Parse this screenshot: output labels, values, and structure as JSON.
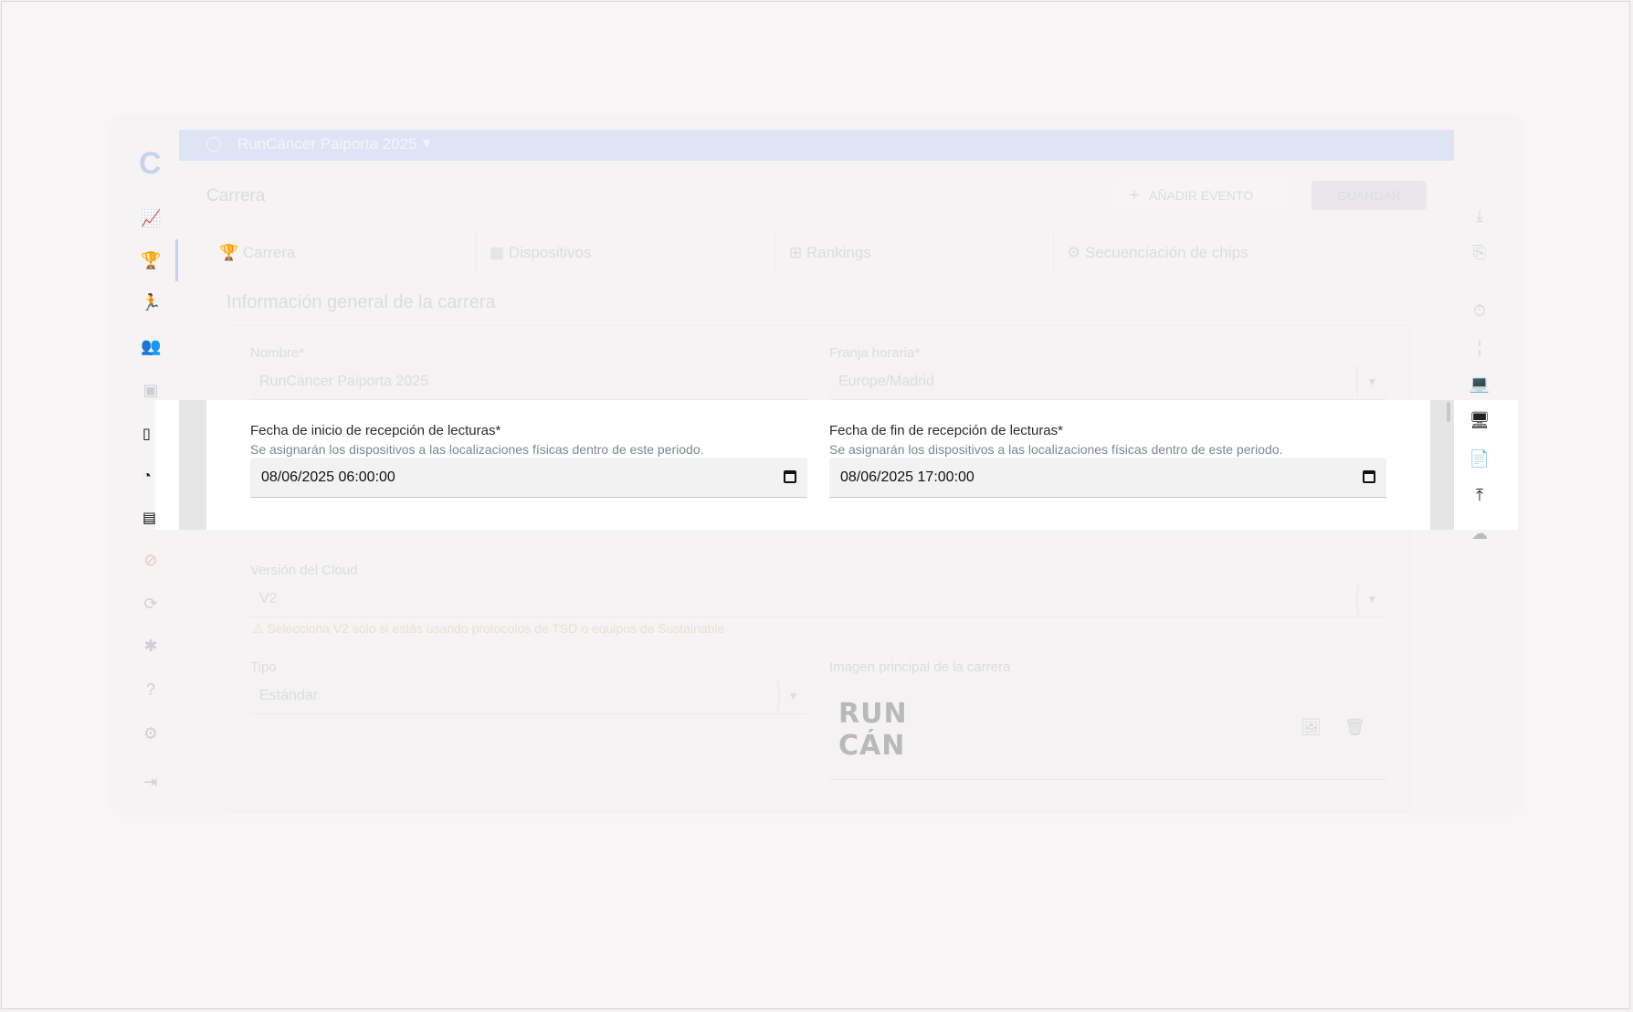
{
  "event_selector": {
    "label": "RunCáncer Paiporta 2025"
  },
  "page": {
    "title": "Carrera",
    "add_event_label": "AÑADIR EVENTO",
    "save_label": "GUARDAR"
  },
  "tabs": [
    {
      "label": "Carrera"
    },
    {
      "label": "Dispositivos"
    },
    {
      "label": "Rankings"
    },
    {
      "label": "Secuenciación de chips"
    }
  ],
  "section": {
    "title": "Información general de la carrera"
  },
  "form": {
    "name": {
      "label": "Nombre*",
      "value": "RunCáncer Paiporta 2025"
    },
    "timezone": {
      "label": "Franja horaria*",
      "value": "Europe/Madrid"
    },
    "start_reading": {
      "label": "Fecha de inicio de recepción de lecturas*",
      "help": "Se asignarán los dispositivos a las localizaciones físicas dentro de este periodo.",
      "value": "08/06/2025 06:00:00"
    },
    "end_reading": {
      "label": "Fecha de fin de recepción de lecturas*",
      "help": "Se asignarán los dispositivos a las localizaciones físicas dentro de este periodo.",
      "value": "08/06/2025 17:00:00"
    },
    "cloud_version": {
      "label": "Versión del Cloud",
      "value": "V2",
      "warning": "Selecciona V2 sólo si estás usando protocolos de TSD o equipos de Sustainable"
    },
    "type": {
      "label": "Tipo",
      "value": "Estándar"
    },
    "main_image": {
      "label": "Imagen principal de la carrera",
      "logo_text": "RUN CÁN"
    }
  },
  "colors": {
    "accent": "#c9d2ec",
    "topbar": "#dfe4f4",
    "help_text": "#7c8796"
  }
}
